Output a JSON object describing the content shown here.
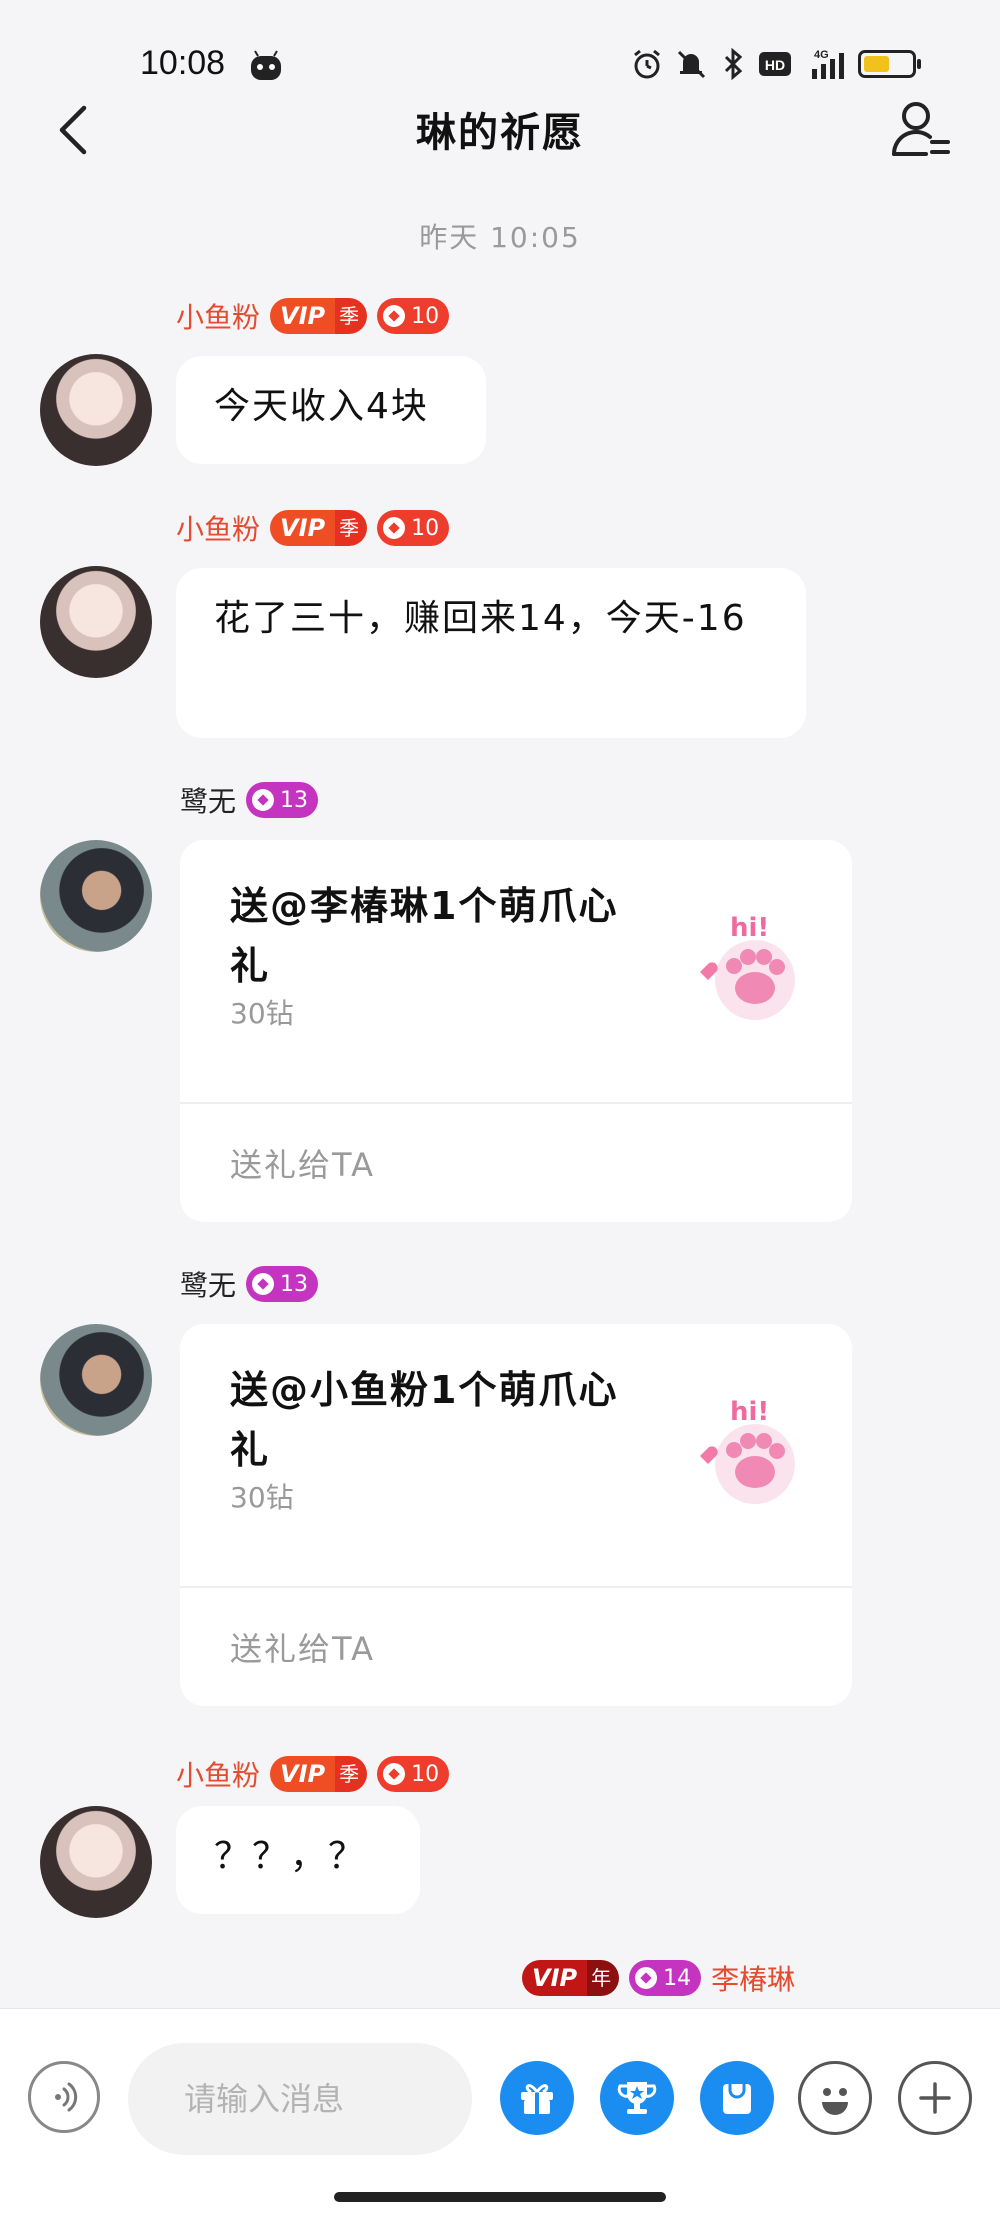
{
  "status": {
    "time": "10:08",
    "network": "4G",
    "hd": "HD",
    "battery_level": 0.6
  },
  "nav": {
    "title": "琳的祈愿"
  },
  "chat": {
    "timestamp": "昨天 10:05",
    "messages": [
      {
        "sender": "小鱼粉",
        "vip": "VIP",
        "vip_tier": "季",
        "level": "10",
        "text": "今天收入4块"
      },
      {
        "sender": "小鱼粉",
        "vip": "VIP",
        "vip_tier": "季",
        "level": "10",
        "text": "花了三十，赚回来14，今天-16"
      },
      {
        "sender": "鹭无",
        "level": "13",
        "gift_text": "送@李椿琳1个萌爪心礼",
        "gift_price": "30钻",
        "gift_action": "送礼给TA"
      },
      {
        "sender": "鹭无",
        "level": "13",
        "gift_text": "送@小鱼粉1个萌爪心礼",
        "gift_price": "30钻",
        "gift_action": "送礼给TA"
      },
      {
        "sender": "小鱼粉",
        "vip": "VIP",
        "vip_tier": "季",
        "level": "10",
        "text": "？？，？"
      },
      {
        "sender": "李椿琳",
        "vip": "VIP",
        "vip_tier": "年",
        "level": "14"
      }
    ]
  },
  "gift_sticker_text": "hi!",
  "input": {
    "placeholder": "请输入消息"
  },
  "toolbar": {
    "icons": [
      "voice-icon",
      "gift-icon",
      "trophy-icon",
      "bag-icon",
      "emoji-icon",
      "plus-icon"
    ]
  },
  "colors": {
    "accent_blue": "#1b8df0",
    "name_red": "#e54b2f",
    "level_red": "#ef3d2d",
    "level_pink": "#c434c0"
  }
}
